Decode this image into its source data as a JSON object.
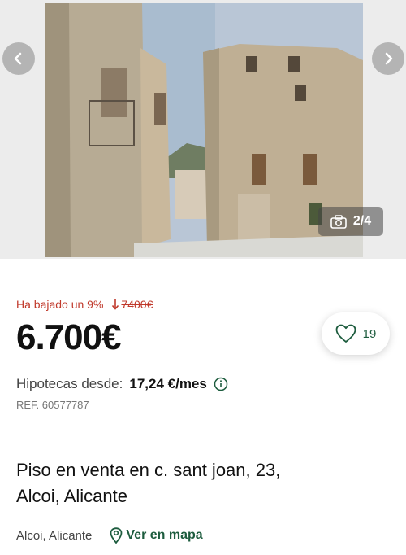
{
  "gallery": {
    "counter": "2/4",
    "icons": {
      "prev": "chevron-left-icon",
      "next": "chevron-right-icon",
      "camera": "camera-icon"
    }
  },
  "listing": {
    "price_drop_label": "Ha bajado un 9%",
    "old_price": "7400€",
    "price": "6.700€",
    "favorites_count": "19",
    "mortgage_label": "Hipotecas desde:",
    "mortgage_amount": "17,24 €/mes",
    "reference": "REF. 60577787",
    "title": "Piso en venta en c. sant joan, 23, Alcoi, Alicante",
    "location": "Alcoi, Alicante",
    "map_link": "Ver en mapa"
  },
  "colors": {
    "accent": "#1d5c3e",
    "price_drop": "#c0392b"
  }
}
